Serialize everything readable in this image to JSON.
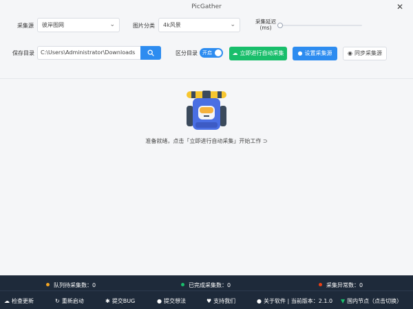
{
  "window": {
    "title": "PicGather",
    "close_glyph": "✕"
  },
  "filters": {
    "source_label": "采集源",
    "source_value": "彼岸图网",
    "category_label": "图片分类",
    "category_value": "4k风景",
    "delay_label_line1": "采集延迟",
    "delay_label_line2": "(ms)",
    "delay_value_fraction": 0
  },
  "save": {
    "label": "保存目录",
    "path": "C:\\Users\\Administrator\\Downloads",
    "separate_label": "区分目录",
    "toggle_text": "开启",
    "toggle_on": true
  },
  "actions": {
    "start_label": "立即进行自动采集",
    "settings_label": "设置采集源",
    "sync_label": "同步采集源"
  },
  "main": {
    "status_message": "准备就绪，点击「立即进行自动采集」开始工作 ⊃"
  },
  "stats": [
    {
      "label": "队列待采集数：0",
      "color": "#f5a623"
    },
    {
      "label": "已完成采集数：0",
      "color": "#19be6b"
    },
    {
      "label": "采集异常数：0",
      "color": "#ed4014"
    }
  ],
  "footer_links": [
    {
      "label": "检查更新",
      "icon": "cloud-icon"
    },
    {
      "label": "重新启动",
      "icon": "restart-icon"
    },
    {
      "label": "提交BUG",
      "icon": "bug-icon"
    },
    {
      "label": "提交想法",
      "icon": "bulb-icon"
    },
    {
      "label": "支持我们",
      "icon": "heart-icon"
    },
    {
      "label": "关于软件 | 当前版本：2.1.0",
      "icon": "info-icon"
    },
    {
      "label": "国内节点（点击切换）",
      "icon": "download-icon"
    }
  ],
  "colors": {
    "accent_blue": "#2d8cf0",
    "accent_green": "#19be6b",
    "footer_bg": "#1e2a3a"
  }
}
